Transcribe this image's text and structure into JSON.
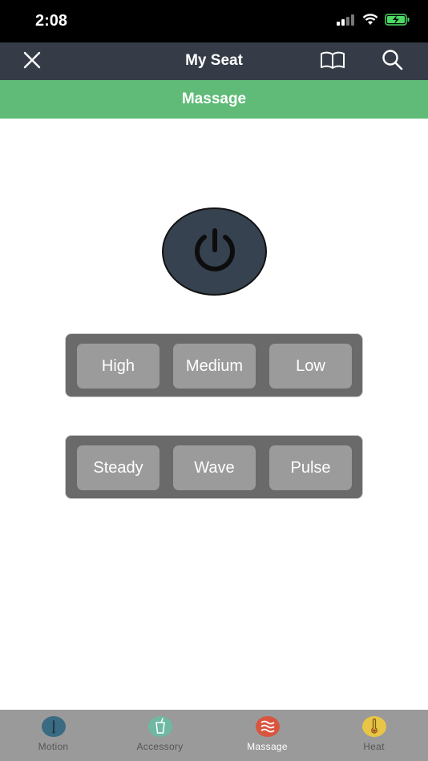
{
  "status_bar": {
    "time": "2:08",
    "icons": [
      "cellular-signal-icon",
      "wifi-icon",
      "battery-charging-icon"
    ]
  },
  "nav": {
    "title": "My Seat",
    "left_icon": "close-icon",
    "right_icons": [
      "book-icon",
      "search-icon"
    ]
  },
  "section": {
    "title": "Massage"
  },
  "power": {
    "icon": "power-icon"
  },
  "intensity_options": [
    "High",
    "Medium",
    "Low"
  ],
  "pattern_options": [
    "Steady",
    "Wave",
    "Pulse"
  ],
  "tabs": [
    {
      "label": "Motion",
      "icon": "motion-icon",
      "color": "#3a6b82"
    },
    {
      "label": "Accessory",
      "icon": "cup-icon",
      "color": "#6fb8a4"
    },
    {
      "label": "Massage",
      "icon": "massage-waves-icon",
      "color": "#d9553f",
      "active": true
    },
    {
      "label": "Heat",
      "icon": "thermometer-icon",
      "color": "#e8c545"
    }
  ],
  "colors": {
    "nav_bg": "#353c47",
    "section_bg": "#5fbb77",
    "power_bg": "#374250",
    "group_bg": "#6a6a6a",
    "option_bg": "#9b9b9b",
    "tabbar_bg": "#9a9a9a"
  }
}
